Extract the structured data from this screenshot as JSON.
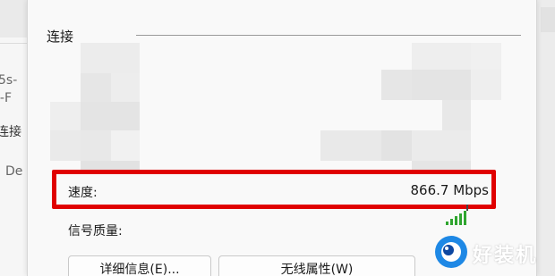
{
  "background_window": {
    "lines": [
      "5s-",
      "i-F",
      "连接",
      "De"
    ]
  },
  "dialog": {
    "section_title": "连接",
    "rows": {
      "speed": {
        "label": "速度:",
        "value": "866.7 Mbps"
      },
      "signal_quality": {
        "label": "信号质量:",
        "bars_filled": 5,
        "bars_total": 5,
        "bar_color": "#2fa52f"
      }
    },
    "buttons": {
      "details": "详细信息(E)...",
      "wireless_properties": "无线属性(W)"
    }
  },
  "highlight_color": "#e00000",
  "watermark": {
    "text": "好装机",
    "logo_color": "#1e88e5"
  }
}
